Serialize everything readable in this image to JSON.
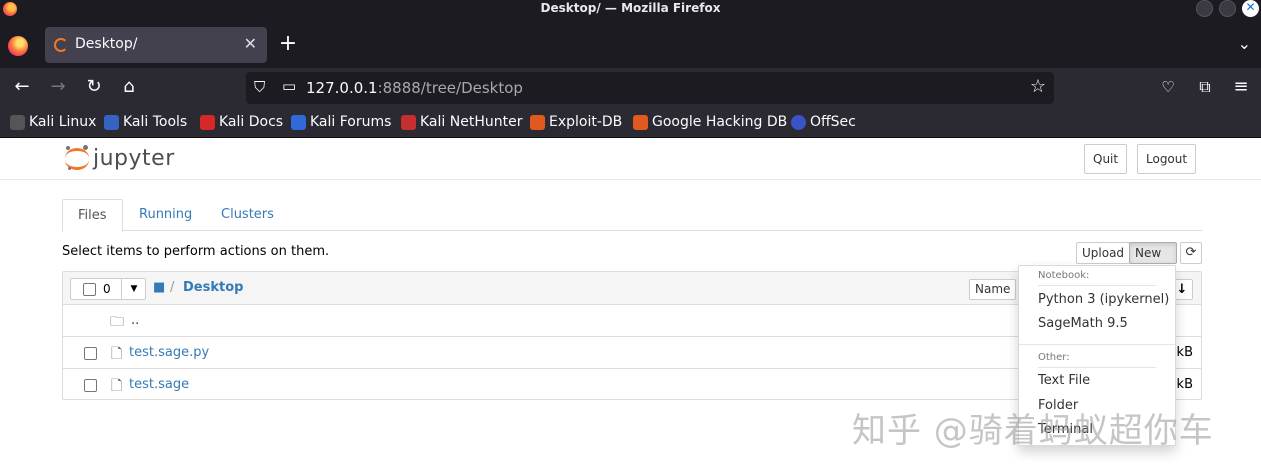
{
  "window": {
    "title": "Desktop/ — Mozilla Firefox"
  },
  "browser": {
    "tab_title": "Desktop/",
    "url_host": "127.0.0.1",
    "url_rest": ":8888/tree/Desktop",
    "bookmarks": [
      {
        "label": "Kali Linux",
        "color": "#2b2a33"
      },
      {
        "label": "Kali Tools",
        "color": "#3563c2"
      },
      {
        "label": "Kali Docs",
        "color": "#d62828"
      },
      {
        "label": "Kali Forums",
        "color": "#2e6bd8"
      },
      {
        "label": "Kali NetHunter",
        "color": "#c62f2f"
      },
      {
        "label": "Exploit-DB",
        "color": "#e05a1f"
      },
      {
        "label": "Google Hacking DB",
        "color": "#e05a1f"
      },
      {
        "label": "OffSec",
        "color": "#3a54c8"
      }
    ]
  },
  "jupyter": {
    "logo_text": "jupyter",
    "quit_label": "Quit",
    "logout_label": "Logout",
    "tabs": [
      {
        "label": "Files",
        "active": true
      },
      {
        "label": "Running",
        "active": false
      },
      {
        "label": "Clusters",
        "active": false
      }
    ],
    "instructions": "Select items to perform actions on them.",
    "upload_label": "Upload",
    "new_label": "New",
    "selected_count": "0",
    "breadcrumb": "Desktop",
    "sort_name_label": "Name",
    "files": [
      {
        "name": "..",
        "type": "folder",
        "size": ""
      },
      {
        "name": "test.sage.py",
        "type": "file",
        "size": "kB"
      },
      {
        "name": "test.sage",
        "type": "file",
        "size": "kB"
      }
    ],
    "new_menu": {
      "notebook_header": "Notebook:",
      "notebook_items": [
        "Python 3 (ipykernel)",
        "SageMath 9.5"
      ],
      "other_header": "Other:",
      "other_items": [
        "Text File",
        "Folder",
        "Terminal"
      ]
    }
  },
  "watermark": "知乎 @骑着蚂蚁超你车"
}
